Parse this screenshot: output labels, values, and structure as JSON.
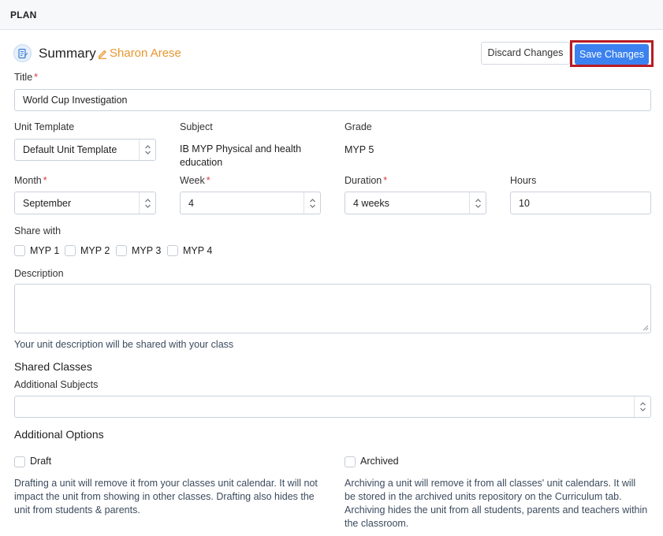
{
  "header": {
    "title": "PLAN"
  },
  "summary": {
    "title": "Summary",
    "owner": "Sharon Arese",
    "discard_label": "Discard Changes",
    "save_label": "Save Changes"
  },
  "fields": {
    "title": {
      "label": "Title",
      "value": "World Cup Investigation"
    },
    "unit_template": {
      "label": "Unit Template",
      "value": "Default Unit Template"
    },
    "subject": {
      "label": "Subject",
      "value": "IB MYP Physical and health education"
    },
    "grade": {
      "label": "Grade",
      "value": "MYP 5"
    },
    "month": {
      "label": "Month",
      "value": "September"
    },
    "week": {
      "label": "Week",
      "value": "4"
    },
    "duration": {
      "label": "Duration",
      "value": "4 weeks"
    },
    "hours": {
      "label": "Hours",
      "value": "10"
    }
  },
  "share_with": {
    "label": "Share with",
    "options": [
      "MYP 1",
      "MYP 2",
      "MYP 3",
      "MYP 4"
    ]
  },
  "description": {
    "label": "Description",
    "value": "",
    "help": "Your unit description will be shared with your class"
  },
  "shared_classes": {
    "heading": "Shared Classes",
    "additional_subjects_label": "Additional Subjects",
    "additional_subjects_value": ""
  },
  "additional_options": {
    "heading": "Additional Options",
    "draft": {
      "label": "Draft",
      "description": "Drafting a unit will remove it from your classes unit calendar. It will not impact the unit from showing in other classes. Drafting also hides the unit from students & parents."
    },
    "archived": {
      "label": "Archived",
      "description": "Archiving a unit will remove it from all classes' unit calendars. It will be stored in the archived units repository on the Curriculum tab. Archiving hides the unit from all students, parents and teachers within the classroom."
    }
  },
  "colors": {
    "accent": "#3b82f0",
    "owner": "#e8962e",
    "highlight": "#b81c22",
    "required": "#e0393e"
  },
  "icons": [
    "summary-doc-icon",
    "pencil-icon",
    "chevron-updown-icon"
  ]
}
